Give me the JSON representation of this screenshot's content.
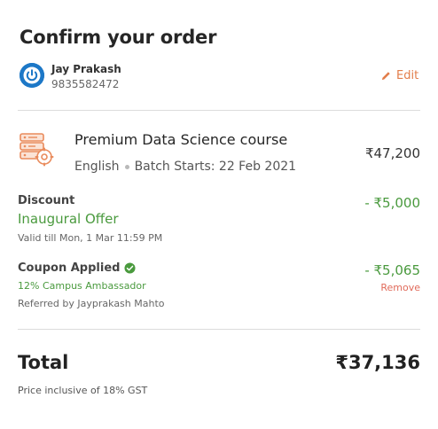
{
  "page": {
    "title": "Confirm your order"
  },
  "user": {
    "avatar_icon": "power-icon",
    "name": "Jay Prakash",
    "phone": "9835582472",
    "edit_label": "Edit"
  },
  "course": {
    "icon": "database-gear-icon",
    "name": "Premium Data Science course",
    "language": "English",
    "batch": "Batch Starts: 22 Feb 2021",
    "price": "₹47,200"
  },
  "discount": {
    "label": "Discount",
    "name": "Inaugural Offer",
    "validity": "Valid till Mon, 1 Mar 11:59 PM",
    "amount": "- ₹5,000"
  },
  "coupon": {
    "label": "Coupon Applied",
    "status_icon": "check-circle-icon",
    "name": "12% Campus Ambassador",
    "referrer": "Referred by Jayprakash Mahto",
    "amount": "- ₹5,065",
    "remove_label": "Remove"
  },
  "total": {
    "label": "Total",
    "amount": "₹37,136",
    "note": "Price inclusive of 18% GST"
  },
  "colors": {
    "accent_orange": "#e27d4a",
    "success_green": "#4a9a3e",
    "avatar_blue": "#1d78c7",
    "remove_red": "#e06a5a"
  }
}
